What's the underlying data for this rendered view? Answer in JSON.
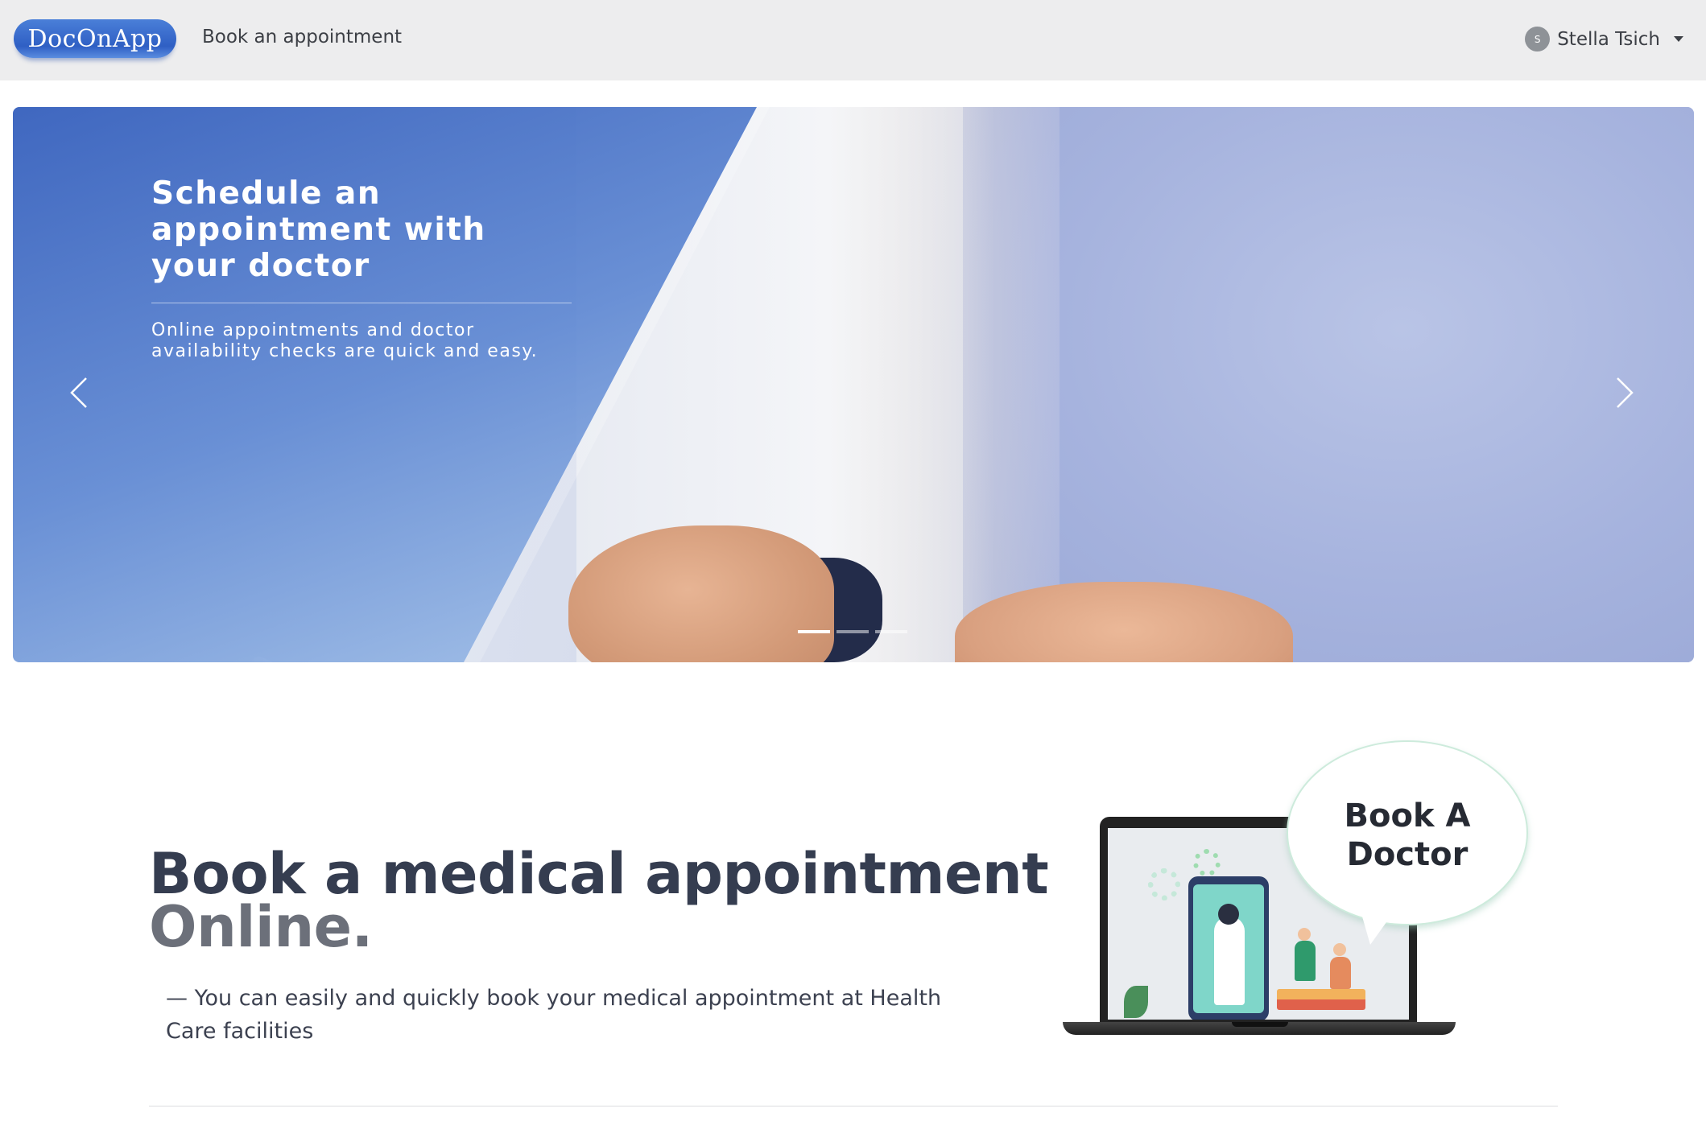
{
  "navbar": {
    "brand": "DocOnApp",
    "link": "Book an appointment",
    "user": {
      "initial": "S",
      "name": "Stella Tsich"
    }
  },
  "carousel": {
    "title": "Schedule an appointment with your doctor",
    "text": "Online appointments and doctor availability checks are quick and easy.",
    "slides": 3,
    "active_slide": 1
  },
  "section": {
    "headline": "Book a medical appointment",
    "headline_muted": "Online.",
    "lead": "— You can easily and quickly book your medical appointment at Health Care facilities",
    "illustration_text": "Book A Doctor"
  },
  "colors": {
    "brand": "#3a6fd0",
    "navbar_bg": "#ededee",
    "heading": "#353d50"
  }
}
